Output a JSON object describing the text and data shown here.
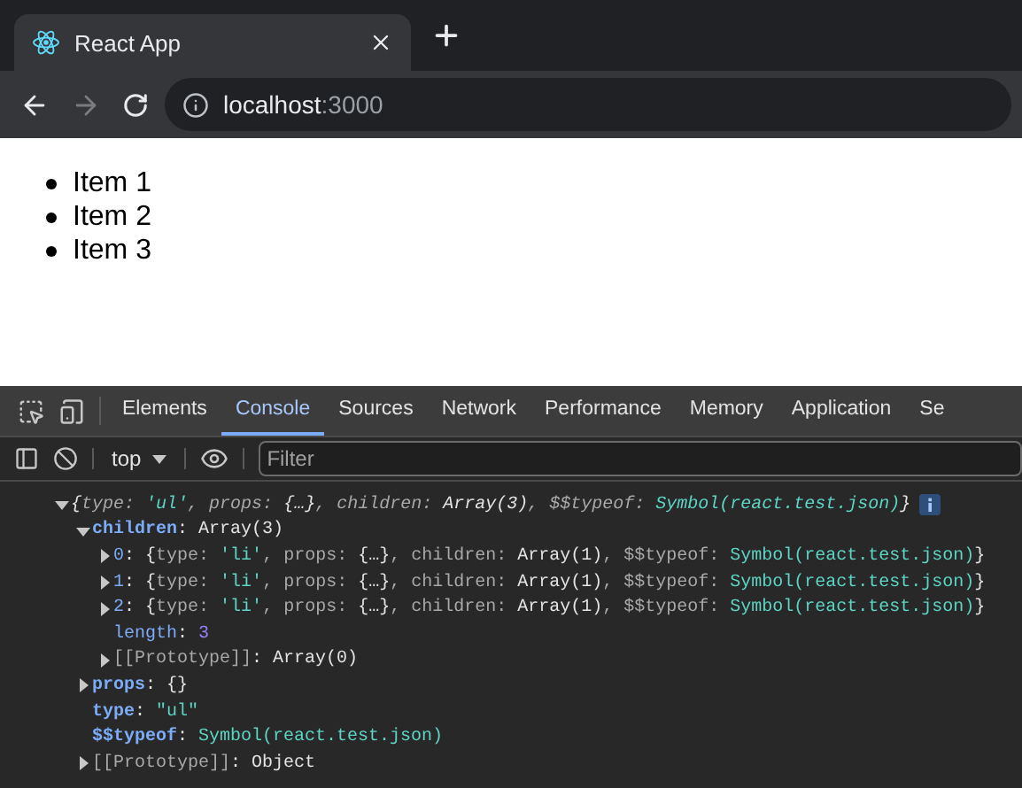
{
  "browser": {
    "tabs": [
      {
        "title": "React App",
        "selected": true
      }
    ],
    "address": {
      "host": "localhost",
      "port": ":3000"
    },
    "forward_disabled": true
  },
  "page": {
    "list_items": [
      "Item 1",
      "Item 2",
      "Item 3"
    ]
  },
  "devtools": {
    "tabs": [
      {
        "label": "Elements",
        "selected": false
      },
      {
        "label": "Console",
        "selected": true
      },
      {
        "label": "Sources",
        "selected": false
      },
      {
        "label": "Network",
        "selected": false
      },
      {
        "label": "Performance",
        "selected": false
      },
      {
        "label": "Memory",
        "selected": false
      },
      {
        "label": "Application",
        "selected": false
      },
      {
        "label": "Se",
        "selected": false
      }
    ],
    "context": "top",
    "filter": {
      "placeholder": "Filter"
    },
    "console": [
      {
        "expanded": true,
        "preview": true,
        "tokens": [
          {
            "kind": "punct",
            "text": "{"
          },
          {
            "kind": "prop",
            "text": "type: "
          },
          {
            "kind": "string",
            "text": "'ul'"
          },
          {
            "kind": "prop",
            "text": ", props: "
          },
          {
            "kind": "punct",
            "text": "{…}"
          },
          {
            "kind": "prop",
            "text": ", children: "
          },
          {
            "kind": "punct",
            "text": "Array(3)"
          },
          {
            "kind": "prop",
            "text": ", $$typeof: "
          },
          {
            "kind": "string",
            "text": "Symbol(react.test.json)"
          },
          {
            "kind": "punct",
            "text": "}"
          }
        ],
        "children": [
          {
            "expanded": true,
            "tokens": [
              {
                "kind": "key",
                "text": "children"
              },
              {
                "kind": "punct",
                "text": ": Array(3)"
              }
            ],
            "children": [
              {
                "expanded": false,
                "tokens": [
                  {
                    "kind": "index",
                    "text": "0"
                  },
                  {
                    "kind": "punct",
                    "text": ": {"
                  },
                  {
                    "kind": "prop",
                    "text": "type: "
                  },
                  {
                    "kind": "string",
                    "text": "'li'"
                  },
                  {
                    "kind": "prop",
                    "text": ", props: "
                  },
                  {
                    "kind": "punct",
                    "text": "{…}"
                  },
                  {
                    "kind": "prop",
                    "text": ", children: "
                  },
                  {
                    "kind": "punct",
                    "text": "Array(1)"
                  },
                  {
                    "kind": "prop",
                    "text": ", $$typeof: "
                  },
                  {
                    "kind": "string",
                    "text": "Symbol(react.test.json)"
                  },
                  {
                    "kind": "punct",
                    "text": "}"
                  }
                ]
              },
              {
                "expanded": false,
                "tokens": [
                  {
                    "kind": "index",
                    "text": "1"
                  },
                  {
                    "kind": "punct",
                    "text": ": {"
                  },
                  {
                    "kind": "prop",
                    "text": "type: "
                  },
                  {
                    "kind": "string",
                    "text": "'li'"
                  },
                  {
                    "kind": "prop",
                    "text": ", props: "
                  },
                  {
                    "kind": "punct",
                    "text": "{…}"
                  },
                  {
                    "kind": "prop",
                    "text": ", children: "
                  },
                  {
                    "kind": "punct",
                    "text": "Array(1)"
                  },
                  {
                    "kind": "prop",
                    "text": ", $$typeof: "
                  },
                  {
                    "kind": "string",
                    "text": "Symbol(react.test.json)"
                  },
                  {
                    "kind": "punct",
                    "text": "}"
                  }
                ]
              },
              {
                "expanded": false,
                "tokens": [
                  {
                    "kind": "index",
                    "text": "2"
                  },
                  {
                    "kind": "punct",
                    "text": ": {"
                  },
                  {
                    "kind": "prop",
                    "text": "type: "
                  },
                  {
                    "kind": "string",
                    "text": "'li'"
                  },
                  {
                    "kind": "prop",
                    "text": ", props: "
                  },
                  {
                    "kind": "punct",
                    "text": "{…}"
                  },
                  {
                    "kind": "prop",
                    "text": ", children: "
                  },
                  {
                    "kind": "punct",
                    "text": "Array(1)"
                  },
                  {
                    "kind": "prop",
                    "text": ", $$typeof: "
                  },
                  {
                    "kind": "string",
                    "text": "Symbol(react.test.json)"
                  },
                  {
                    "kind": "punct",
                    "text": "}"
                  }
                ]
              },
              {
                "tokens": [
                  {
                    "kind": "index",
                    "text": "length"
                  },
                  {
                    "kind": "punct",
                    "text": ": "
                  },
                  {
                    "kind": "number",
                    "text": "3"
                  }
                ]
              },
              {
                "expanded": false,
                "tokens": [
                  {
                    "kind": "internal",
                    "text": "[[Prototype]]"
                  },
                  {
                    "kind": "punct",
                    "text": ": Array(0)"
                  }
                ]
              }
            ]
          },
          {
            "expanded": false,
            "tokens": [
              {
                "kind": "key",
                "text": "props"
              },
              {
                "kind": "punct",
                "text": ": {}"
              }
            ]
          },
          {
            "tokens": [
              {
                "kind": "key",
                "text": "type"
              },
              {
                "kind": "punct",
                "text": ": "
              },
              {
                "kind": "string",
                "text": "\"ul\""
              }
            ]
          },
          {
            "tokens": [
              {
                "kind": "key",
                "text": "$$typeof"
              },
              {
                "kind": "punct",
                "text": ": "
              },
              {
                "kind": "string",
                "text": "Symbol(react.test.json)"
              }
            ]
          },
          {
            "expanded": false,
            "tokens": [
              {
                "kind": "internal",
                "text": "[[Prototype]]"
              },
              {
                "kind": "punct",
                "text": ": Object"
              }
            ]
          }
        ]
      }
    ]
  }
}
